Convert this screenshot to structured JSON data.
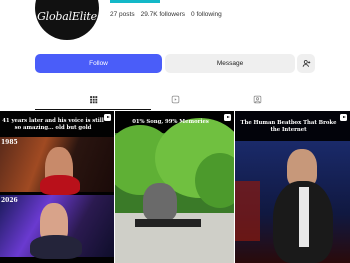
{
  "profile": {
    "avatar_text": "GlobalElite",
    "posts": "27 posts",
    "followers": "29.7K followers",
    "following": "0 following"
  },
  "actions": {
    "follow_label": "Follow",
    "message_label": "Message"
  },
  "tabs": [
    {
      "icon": "grid-icon",
      "active": true
    },
    {
      "icon": "reels-icon",
      "active": false
    },
    {
      "icon": "tagged-icon",
      "active": false
    }
  ],
  "posts": [
    {
      "title": "41 years later and his voice is still so amazing... old but gold",
      "year_top": "1985",
      "year_bottom": "2026",
      "type_icon": "reel-icon"
    },
    {
      "title": "01% Song, 99% Memories",
      "type_icon": "reel-icon"
    },
    {
      "title": "The Human Beatbox That Broke the Internet",
      "type_icon": "reel-icon"
    }
  ],
  "colors": {
    "follow_button": "#4a5df9",
    "secondary_button": "#efefef",
    "accent_bar": "#13b8c8"
  }
}
